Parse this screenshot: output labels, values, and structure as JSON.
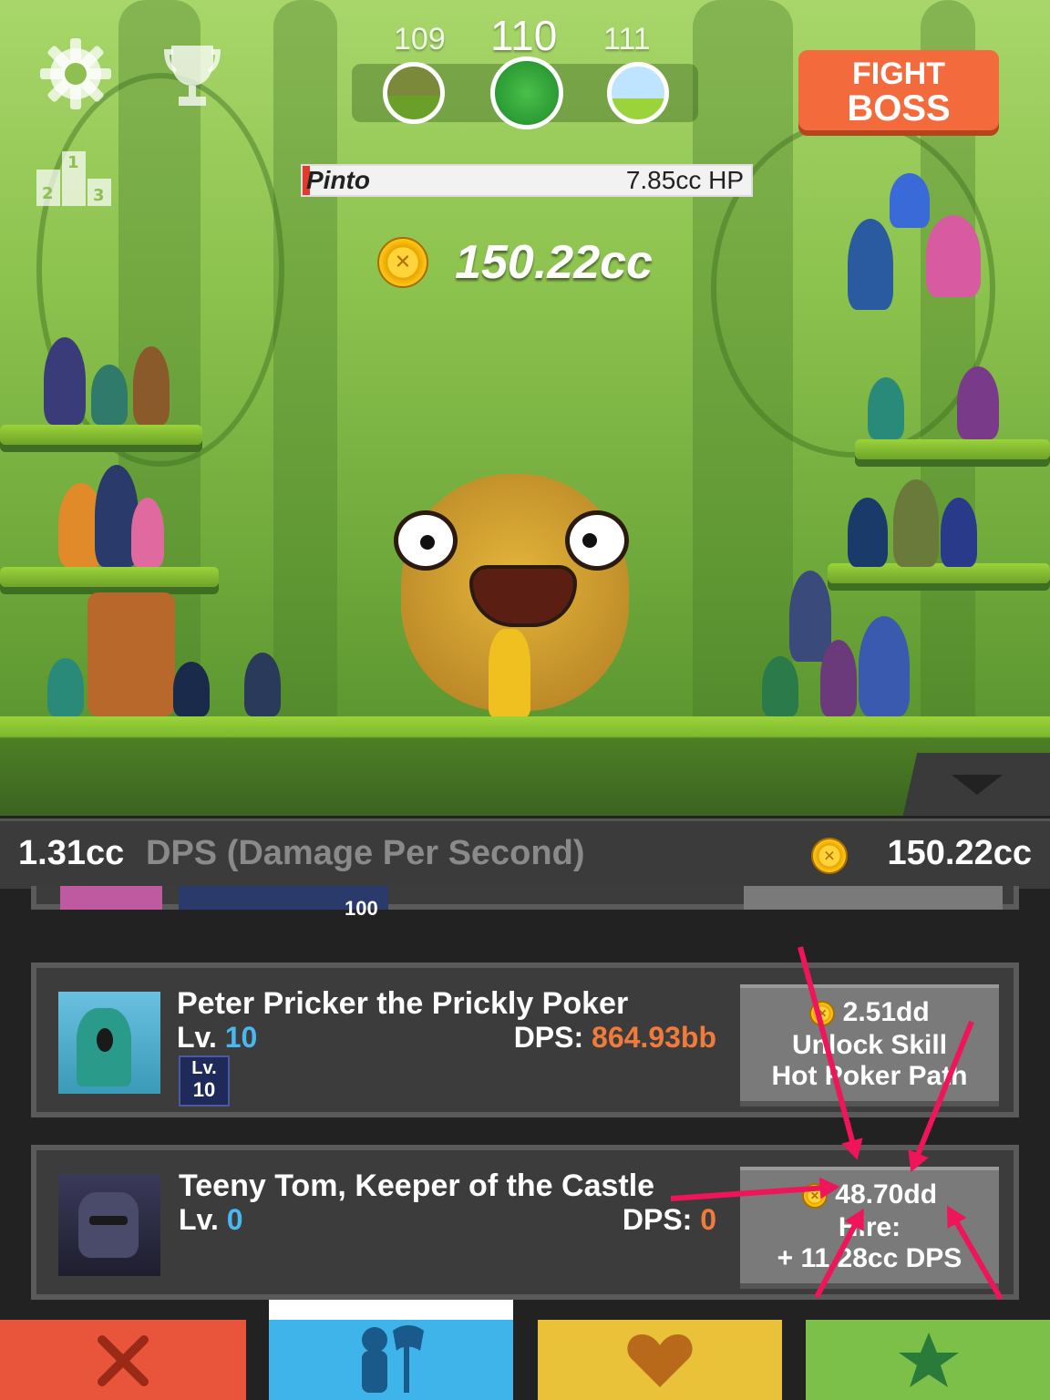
{
  "stages": {
    "prev": "109",
    "current": "110",
    "next": "111"
  },
  "fight_boss": {
    "line1": "FIGHT",
    "line2": "BOSS"
  },
  "leaderboard": {
    "first": "1",
    "second": "2",
    "third": "3"
  },
  "enemy": {
    "name": "Pinto",
    "hp": "7.85cc HP"
  },
  "gold_display": "150.22cc",
  "stats_bar": {
    "dps_value": "1.31cc",
    "dps_label": "DPS (Damage Per Second)",
    "gold": "150.22cc"
  },
  "partial_card": {
    "level_badge": "100"
  },
  "heroes": [
    {
      "name": "Peter Pricker the Prickly Poker",
      "level_label": "Lv.",
      "level": "10",
      "dps_label": "DPS:",
      "dps": "864.93bb",
      "badge_label": "Lv.",
      "badge_level": "10",
      "button": {
        "cost": "2.51dd",
        "line1": "Unlock Skill",
        "line2": "Hot Poker Path"
      }
    },
    {
      "name": "Teeny Tom, Keeper of the Castle",
      "level_label": "Lv.",
      "level": "0",
      "dps_label": "DPS:",
      "dps": "0",
      "button": {
        "cost": "48.70dd",
        "line1": "Hire:",
        "line2": "+ 11.28cc DPS"
      }
    }
  ],
  "nav_tabs": [
    {
      "icon": "crossed-swords-icon",
      "color": "#e8553a"
    },
    {
      "icon": "hero-axe-icon",
      "color": "#3fb4ea",
      "active": true
    },
    {
      "icon": "heart-shield-icon",
      "color": "#e9c23a"
    },
    {
      "icon": "star-icon",
      "color": "#7cc04a"
    }
  ],
  "colors": {
    "accent_orange": "#f36a3c",
    "level_blue": "#49b8f0",
    "dps_orange": "#f07b3a",
    "annotation_pink": "#f0145a"
  }
}
